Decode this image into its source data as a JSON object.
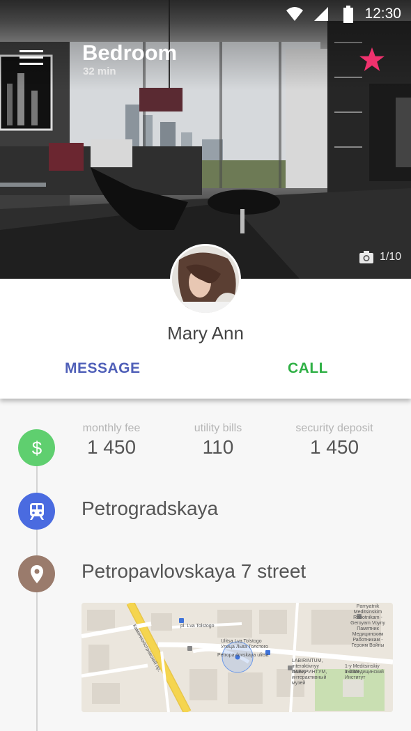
{
  "status_bar": {
    "time": "12:30"
  },
  "header": {
    "title": "Bedroom",
    "subtitle": "32 min"
  },
  "photo": {
    "counter": "1/10"
  },
  "profile": {
    "name": "Mary Ann"
  },
  "actions": {
    "message_label": "MESSAGE",
    "call_label": "CALL"
  },
  "fees": [
    {
      "label": "monthly fee",
      "value": "1 450"
    },
    {
      "label": "utility bills",
      "value": "110"
    },
    {
      "label": "security deposit",
      "value": "1 450"
    }
  ],
  "metro": {
    "station": "Petrogradskaya"
  },
  "address": {
    "street": "Petropavlovskaya 7 street"
  },
  "map": {
    "labels": {
      "road": "Каменноостровский пр.",
      "square": "pl. Lva Tolstogo",
      "street_1": "Ulitsa Lva Tolstogo",
      "street_1_ru": "Улица Льва Толстого",
      "street_2": "Petropavlovskaya ulitsa",
      "museum": "LABIRINTUM, interaktivnyy muzey",
      "museum_ru": "ЛАБИРИНТУМ, интерактивный музей",
      "monument": "Pamyatnik Meditsinskim Rabotnikam - Geroyam Voyny",
      "monument_ru": "Памятник Медицинским Работникам - Героям Войны",
      "institute": "1-y Meditsinskiy Institut",
      "institute_ru": "1-й Медицинский Институт"
    }
  },
  "colors": {
    "money": "#5fcf6f",
    "metro": "#4a6be0",
    "place": "#9a7b6c",
    "message": "#4f5fb8",
    "call": "#2fb045",
    "favorite": "#f0326e"
  }
}
